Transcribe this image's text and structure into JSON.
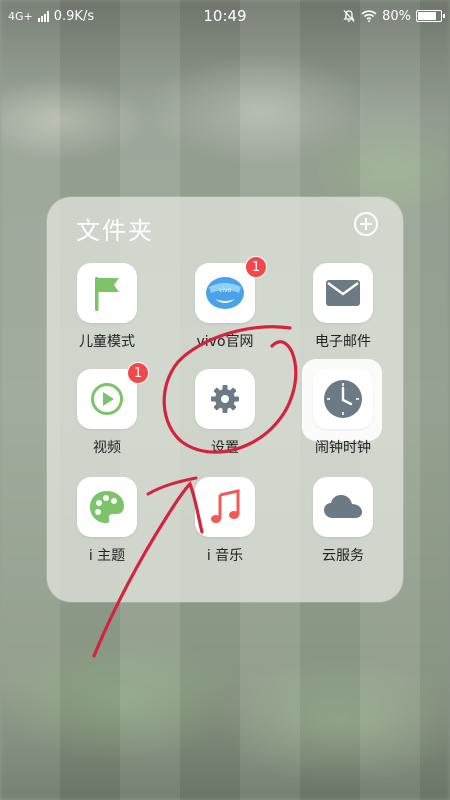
{
  "status_bar": {
    "network": "4G+",
    "speed": "0.9K/s",
    "time": "10:49",
    "battery": "80%",
    "battery_level": 0.8,
    "icons": [
      "signal-icon",
      "mute-icon",
      "wifi-icon",
      "battery-icon"
    ]
  },
  "folder": {
    "title": "文件夹",
    "add_icon": "plus-circle-icon",
    "apps": [
      {
        "label": "儿童模式",
        "icon": "flag-icon",
        "color": "#7cc36a",
        "badge": null
      },
      {
        "label": "vivo官网",
        "icon": "vivo-store-icon",
        "color": "#3a9be6",
        "badge": "1"
      },
      {
        "label": "电子邮件",
        "icon": "envelope-icon",
        "color": "#6c7a86",
        "badge": null
      },
      {
        "label": "视频",
        "icon": "play-icon",
        "color": "#7cc36a",
        "badge": "1"
      },
      {
        "label": "设置",
        "icon": "gear-icon",
        "color": "#6c7a86",
        "badge": null
      },
      {
        "label": "闹钟时钟",
        "icon": "clock-icon",
        "color": "#6c7a86",
        "badge": null
      },
      {
        "label": "i 主题",
        "icon": "palette-icon",
        "color": "#7cc36a",
        "badge": null
      },
      {
        "label": "i 音乐",
        "icon": "music-note-icon",
        "color": "#f25a58",
        "badge": null
      },
      {
        "label": "云服务",
        "icon": "cloud-icon",
        "color": "#6c7a86",
        "badge": null
      }
    ]
  },
  "colors": {
    "annotation": "#d3243c",
    "badge": "#f2484b"
  }
}
